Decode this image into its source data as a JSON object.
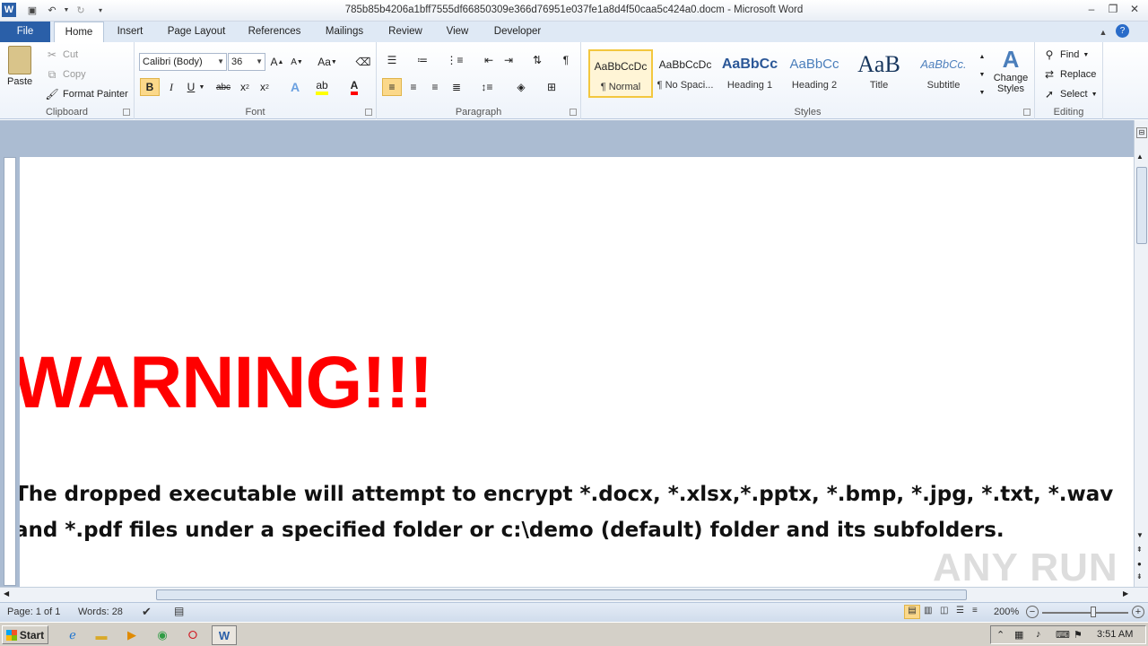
{
  "window": {
    "title": "785b85b4206a1bff7555df66850309e366d76951e037fe1a8d4f50caa5c424a0.docm - Microsoft Word"
  },
  "tabs": [
    "File",
    "Home",
    "Insert",
    "Page Layout",
    "References",
    "Mailings",
    "Review",
    "View",
    "Developer"
  ],
  "ribbon": {
    "clipboard": {
      "paste": "Paste",
      "cut": "Cut",
      "copy": "Copy",
      "format_painter": "Format Painter",
      "label": "Clipboard"
    },
    "font": {
      "family": "Calibri (Body)",
      "size": "36",
      "label": "Font",
      "change_case": "Aa"
    },
    "paragraph": {
      "label": "Paragraph"
    },
    "styles": {
      "label": "Styles",
      "items": [
        {
          "sample": "AaBbCcDc",
          "name": "¶ Normal"
        },
        {
          "sample": "AaBbCcDc",
          "name": "¶ No Spaci..."
        },
        {
          "sample": "AaBbCc",
          "name": "Heading 1"
        },
        {
          "sample": "AaBbCc",
          "name": "Heading 2"
        },
        {
          "sample": "AaB",
          "name": "Title"
        },
        {
          "sample": "AaBbCc.",
          "name": "Subtitle"
        }
      ],
      "change_styles": "Change Styles"
    },
    "editing": {
      "find": "Find",
      "replace": "Replace",
      "select": "Select",
      "label": "Editing"
    }
  },
  "document": {
    "heading": "WARNING!!!",
    "body": "The dropped executable will attempt to encrypt *.docx, *.xlsx,*.pptx, *.bmp, *.jpg, *.txt, *.wav and *.pdf files under a specified folder or c:\\demo (default) folder and its subfolders."
  },
  "statusbar": {
    "page": "Page: 1 of 1",
    "words": "Words: 28",
    "zoom": "200%"
  },
  "taskbar": {
    "start": "Start",
    "clock": "3:51 AM"
  },
  "watermark": "ANY RUN"
}
